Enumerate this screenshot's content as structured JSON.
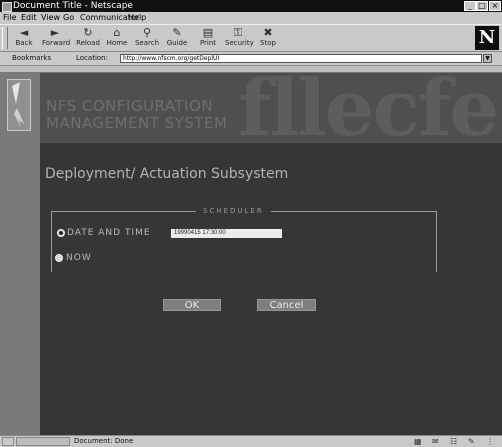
{
  "window": {
    "title": "Document Title - Netscape",
    "controls": {
      "minimize": "_",
      "maximize": "□",
      "close": "×"
    }
  },
  "menu": [
    "File",
    "Edit",
    "View",
    "Go",
    "Communicator",
    "Help"
  ],
  "toolbar": {
    "buttons": [
      {
        "label": "Back",
        "icon": "back-arrow-icon",
        "glyph": "◄"
      },
      {
        "label": "Forward",
        "icon": "forward-arrow-icon",
        "glyph": "►"
      },
      {
        "label": "Reload",
        "icon": "reload-icon",
        "glyph": "↻"
      },
      {
        "label": "Home",
        "icon": "home-icon",
        "glyph": "⌂"
      },
      {
        "label": "Search",
        "icon": "search-icon",
        "glyph": "⚲"
      },
      {
        "label": "Guide",
        "icon": "guide-icon",
        "glyph": "✎"
      },
      {
        "label": "Print",
        "icon": "print-icon",
        "glyph": "▤"
      },
      {
        "label": "Security",
        "icon": "lock-icon",
        "glyph": "⚿"
      },
      {
        "label": "Stop",
        "icon": "stop-icon",
        "glyph": "✖"
      }
    ],
    "brand_glyph": "N"
  },
  "location": {
    "bookmarks_label": "Bookmarks",
    "location_label": "Location:",
    "url": "http://www.nfscm.org/getDeplUI",
    "dropdown_glyph": "▼"
  },
  "page": {
    "system_title": "NFS CONFIGURATION MANAGEMENT SYSTEM",
    "background_letters": "fllecfe",
    "subsystem_title": "Deployment/ Actuation Subsystem",
    "scheduler": {
      "legend": "SCHEDULER",
      "option_datetime": "DATE AND TIME",
      "datetime_value": "19990415 17:30:00",
      "option_now": "NOW",
      "selected": "datetime"
    },
    "buttons": {
      "ok": "OK",
      "cancel": "Cancel"
    }
  },
  "status": {
    "text": "Document: Done"
  },
  "colors": {
    "chrome": "#c9c9c9",
    "page_background": "#363636",
    "header_band": "#4f4f4f",
    "button": "#7e7e7e"
  }
}
